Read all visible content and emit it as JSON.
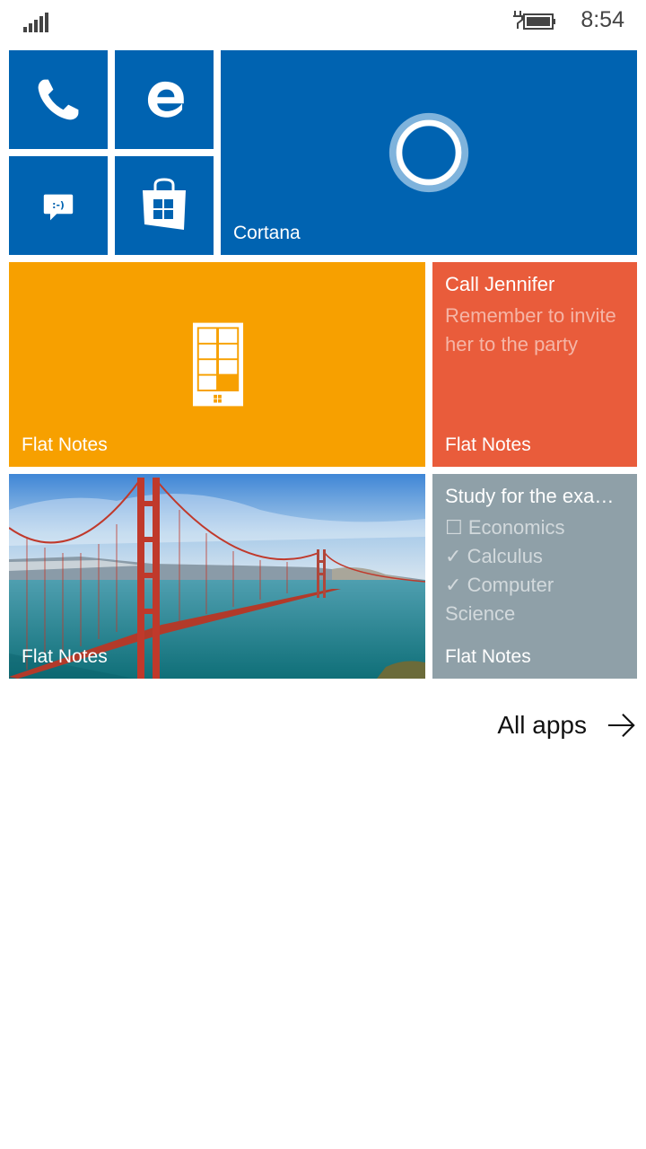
{
  "status": {
    "time": "8:54",
    "signal_icon": "signal-bars-icon",
    "battery_icon": "battery-charging-icon"
  },
  "tiles": {
    "phone": {
      "icon": "phone-icon"
    },
    "edge": {
      "icon": "edge-browser-icon"
    },
    "messaging": {
      "icon": "messaging-icon"
    },
    "store": {
      "icon": "store-icon"
    },
    "cortana": {
      "label": "Cortana",
      "icon": "cortana-circle-icon"
    },
    "flatnotes_main": {
      "label": "Flat Notes",
      "icon": "phone-tiles-icon"
    },
    "note_call": {
      "title": "Call Jennifer",
      "body": "Remember to invite her to the party",
      "label": "Flat Notes"
    },
    "photo": {
      "label": "Flat Notes",
      "description_icon": "golden-gate-bridge-photo"
    },
    "note_study": {
      "title": "Study for the exa…",
      "items": [
        {
          "mark": "☐",
          "text": "Economics"
        },
        {
          "mark": "✓",
          "text": "Calculus"
        },
        {
          "mark": "✓",
          "text": "Computer Science"
        }
      ],
      "label": "Flat Notes"
    }
  },
  "all_apps": {
    "label": "All apps",
    "icon": "arrow-right-icon"
  },
  "colors": {
    "blue": "#0063b1",
    "orange": "#f7a000",
    "red": "#e95c3b",
    "gray": "#8fa0a8"
  }
}
